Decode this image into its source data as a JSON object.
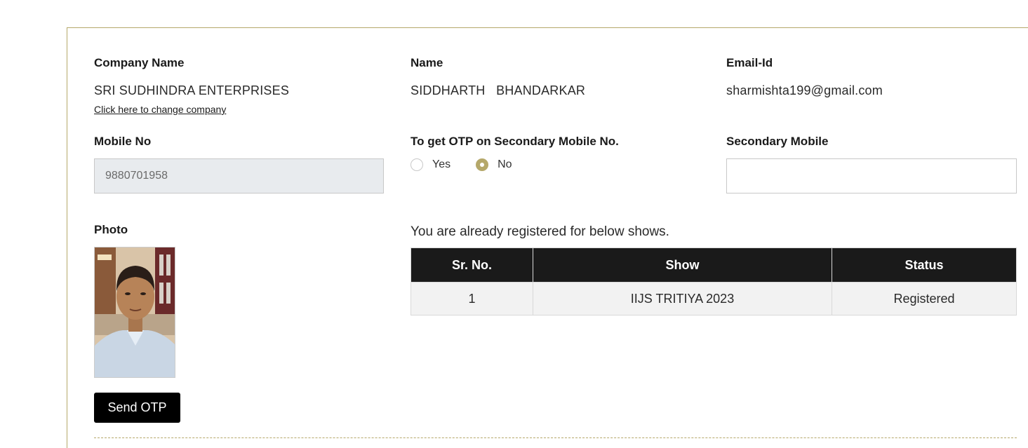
{
  "company": {
    "label": "Company Name",
    "value": "SRI SUDHINDRA ENTERPRISES",
    "change_link": "Click here to change company"
  },
  "name": {
    "label": "Name",
    "value": "SIDDHARTH   BHANDARKAR"
  },
  "email": {
    "label": "Email-Id",
    "value": "sharmishta199@gmail.com"
  },
  "mobile": {
    "label": "Mobile No",
    "value": "9880701958"
  },
  "otp_secondary": {
    "label": "To get OTP on Secondary Mobile No.",
    "options": [
      {
        "label": "Yes",
        "checked": false
      },
      {
        "label": "No",
        "checked": true
      }
    ]
  },
  "secondary_mobile": {
    "label": "Secondary Mobile",
    "value": ""
  },
  "photo": {
    "label": "Photo"
  },
  "send_otp_label": "Send OTP",
  "shows": {
    "notice": "You are already registered for below shows.",
    "columns": [
      "Sr. No.",
      "Show",
      "Status"
    ],
    "rows": [
      [
        "1",
        "IIJS TRITIYA 2023",
        "Registered"
      ]
    ]
  },
  "colors": {
    "accent": "#b5a86a",
    "header_bg": "#1a1a1a",
    "button_bg": "#000000",
    "disabled_input_bg": "#e8ebee"
  }
}
